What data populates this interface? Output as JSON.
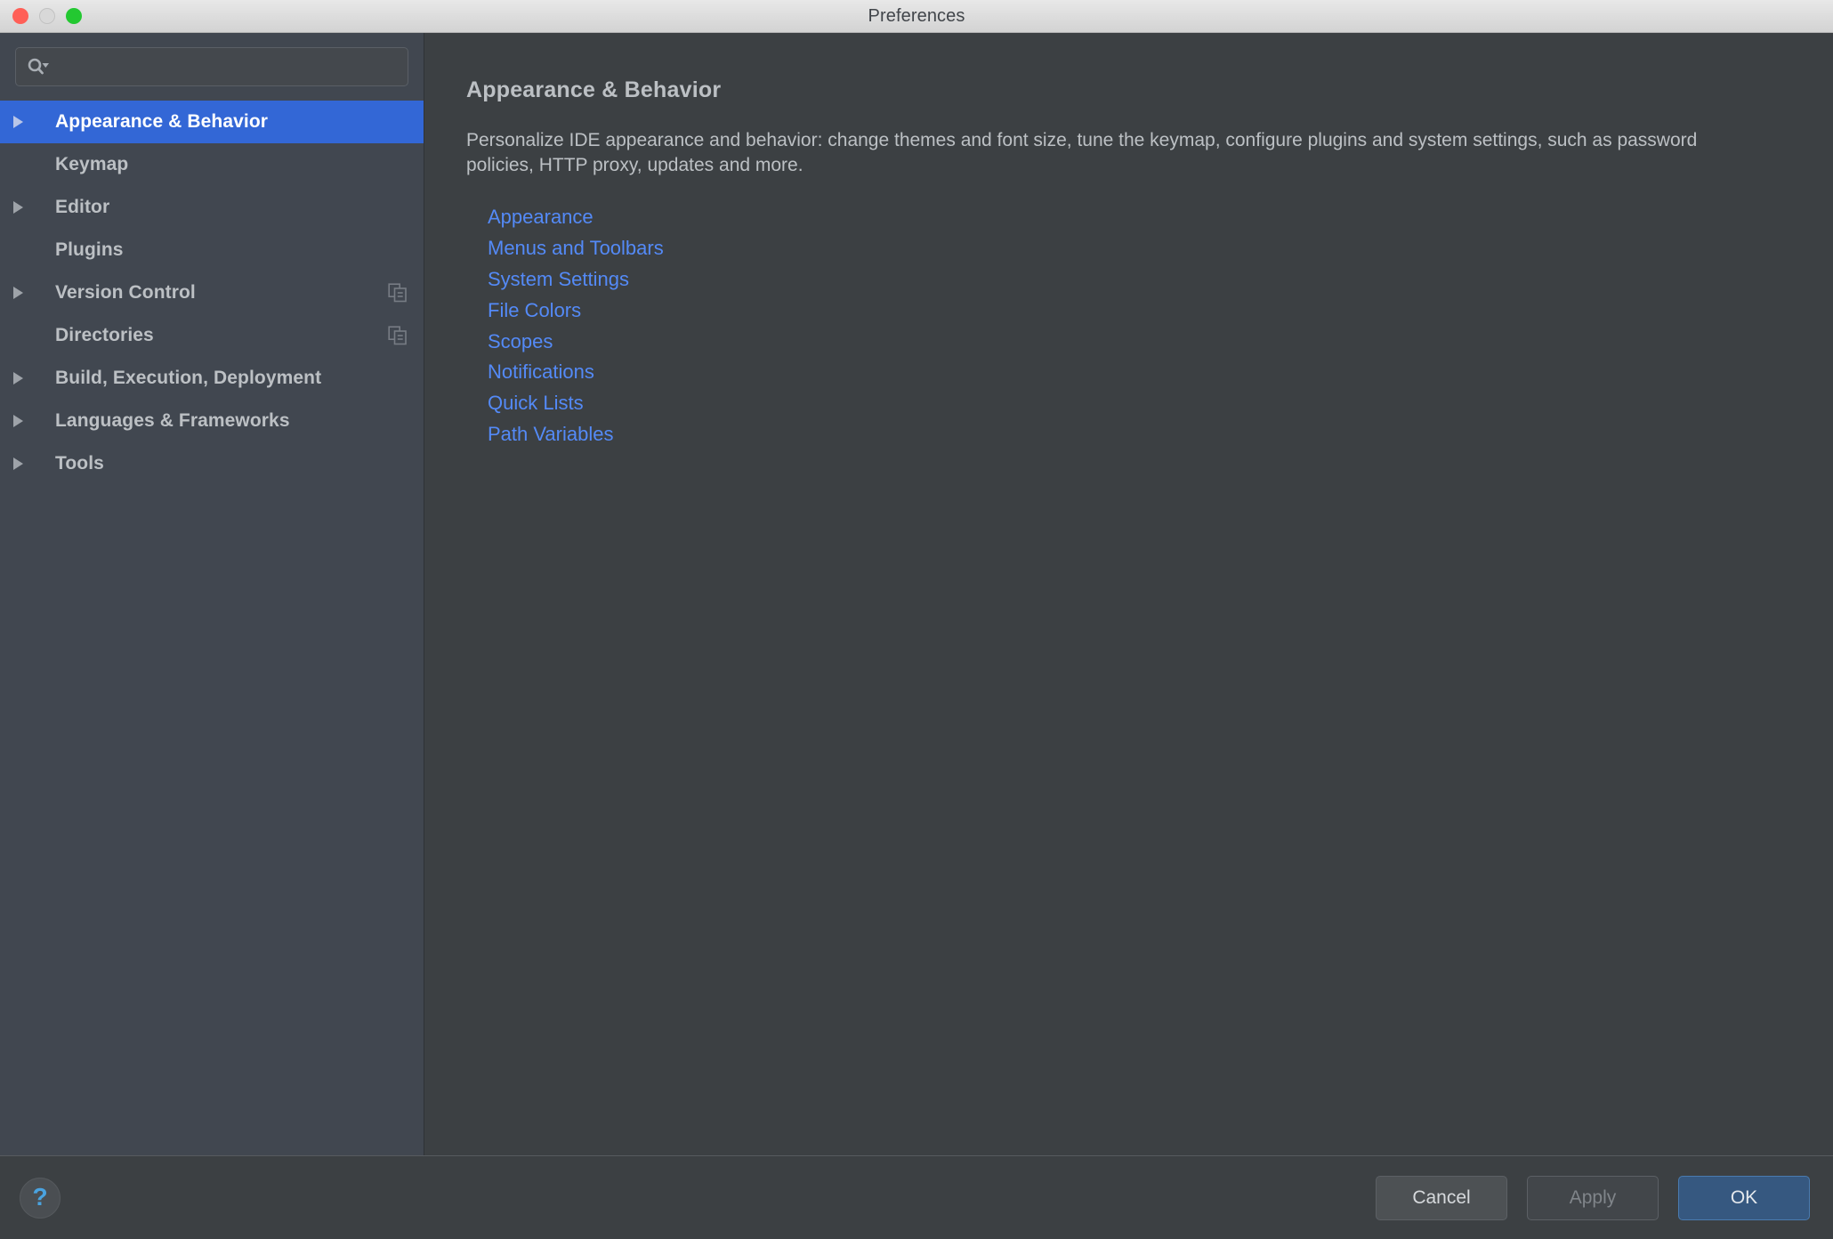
{
  "window": {
    "title": "Preferences",
    "traffic_lights": [
      {
        "name": "close",
        "color": "#ff5f57"
      },
      {
        "name": "minimize",
        "color": "#d8d8d8"
      },
      {
        "name": "maximize",
        "color": "#23c831"
      }
    ]
  },
  "search": {
    "value": "",
    "placeholder": "",
    "icon": "search-icon"
  },
  "sidebar": {
    "items": [
      {
        "label": "Appearance & Behavior",
        "expandable": true,
        "selected": true,
        "badge": null
      },
      {
        "label": "Keymap",
        "expandable": false,
        "selected": false,
        "badge": null
      },
      {
        "label": "Editor",
        "expandable": true,
        "selected": false,
        "badge": null
      },
      {
        "label": "Plugins",
        "expandable": false,
        "selected": false,
        "badge": null
      },
      {
        "label": "Version Control",
        "expandable": true,
        "selected": false,
        "badge": "copy-icon"
      },
      {
        "label": "Directories",
        "expandable": false,
        "selected": false,
        "badge": "copy-icon"
      },
      {
        "label": "Build, Execution, Deployment",
        "expandable": true,
        "selected": false,
        "badge": null
      },
      {
        "label": "Languages & Frameworks",
        "expandable": true,
        "selected": false,
        "badge": null
      },
      {
        "label": "Tools",
        "expandable": true,
        "selected": false,
        "badge": null
      }
    ]
  },
  "main": {
    "title": "Appearance & Behavior",
    "description": "Personalize IDE appearance and behavior: change themes and font size, tune the keymap, configure plugins and system settings, such as password policies, HTTP proxy, updates and more.",
    "links": [
      "Appearance",
      "Menus and Toolbars",
      "System Settings",
      "File Colors",
      "Scopes",
      "Notifications",
      "Quick Lists",
      "Path Variables"
    ]
  },
  "footer": {
    "help_label": "?",
    "cancel_label": "Cancel",
    "apply_label": "Apply",
    "ok_label": "OK"
  },
  "colors": {
    "selection_blue": "#3367d6",
    "link_blue": "#548af7",
    "ok_button": "#365880",
    "sidebar_bg": "#414750",
    "panel_bg": "#3c4043"
  }
}
